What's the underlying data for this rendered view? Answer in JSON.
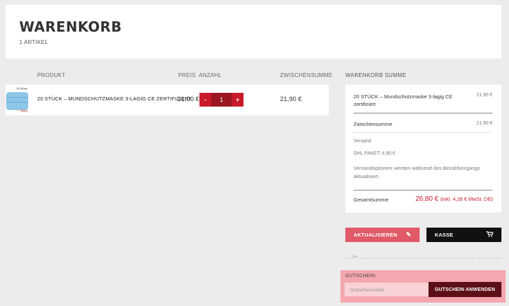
{
  "header": {
    "title": "WARENKORB",
    "article_count": "1 ARTIKEL"
  },
  "table": {
    "columns": [
      "PRODUKT",
      "PREIS",
      "ANZAHL",
      "ZWISCHENSUMME"
    ],
    "rows": [
      {
        "thumb_label": "20 Stück",
        "thumb_logo": "Herz",
        "product": "20 STÜCK – MUNDSCHUTZMASKE 3-LAGIG CE ZERTIFIZIERT",
        "price": "21,90 €",
        "quantity": "1",
        "minus": "-",
        "plus": "+",
        "subtotal": "21,90 €"
      }
    ]
  },
  "summary": {
    "title": "WARENKORB SUMME",
    "item_name": "20 STÜCK – Mundschutzmaske 3-lagig CE zertifiziert",
    "item_price": "21,90 €",
    "subtotal_label": "Zwischensumme",
    "subtotal_value": "21,90 €",
    "shipping_label": "Versand",
    "shipping_method": "DHL PAKET: 4,90 €",
    "shipping_note": "Versandoptionen werden während des Bezahlvorgangs aktualisiert.",
    "total_label": "Gesamtsumme",
    "total_value": "26,80 €",
    "total_tax": "(inkl. 4,28 € MwSt. DE)"
  },
  "actions": {
    "update_label": "AKTUALISIEREN",
    "update_icon": "pencil-icon",
    "checkout_label": "KASSE",
    "checkout_icon": "cart-icon"
  },
  "coupon": {
    "label": "GUTSCHEIN:",
    "placeholder": "Gutscheincode",
    "button_label": "GUTSCHEIN ANWENDEN"
  },
  "colors": {
    "accent": "#c91a2a",
    "update_button": "#e05a68",
    "checkout_button": "#111111",
    "coupon_bg": "#f4a7ae",
    "coupon_button": "#5c0f16"
  }
}
